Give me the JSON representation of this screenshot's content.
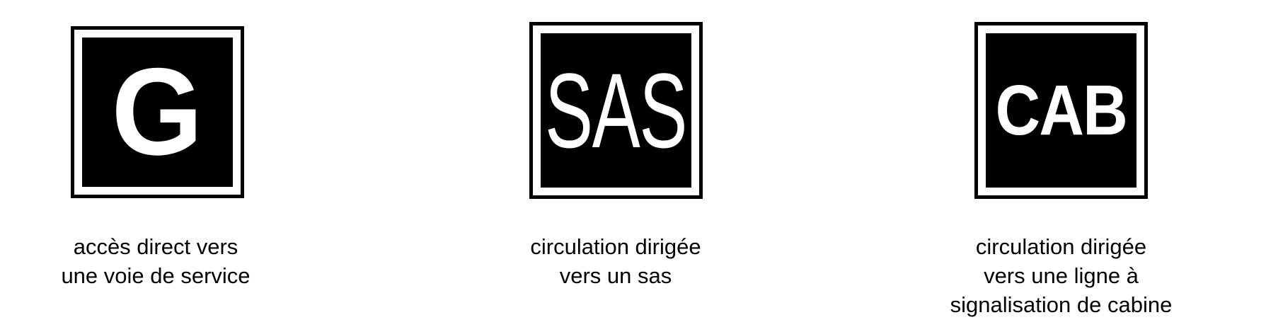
{
  "signs": [
    {
      "letters": "G",
      "caption": [
        "accès direct vers",
        "une voie de service"
      ]
    },
    {
      "letters": "SAS",
      "caption": [
        "circulation dirigée",
        "vers un sas"
      ]
    },
    {
      "letters": "CAB",
      "caption": [
        "circulation dirigée",
        "vers une ligne à",
        "signalisation de cabine"
      ]
    }
  ],
  "colors": {
    "sign_background": "#000000",
    "sign_border": "#ffffff",
    "sign_letters": "#ffffff",
    "caption_text": "#000000",
    "page_background": "#ffffff"
  }
}
